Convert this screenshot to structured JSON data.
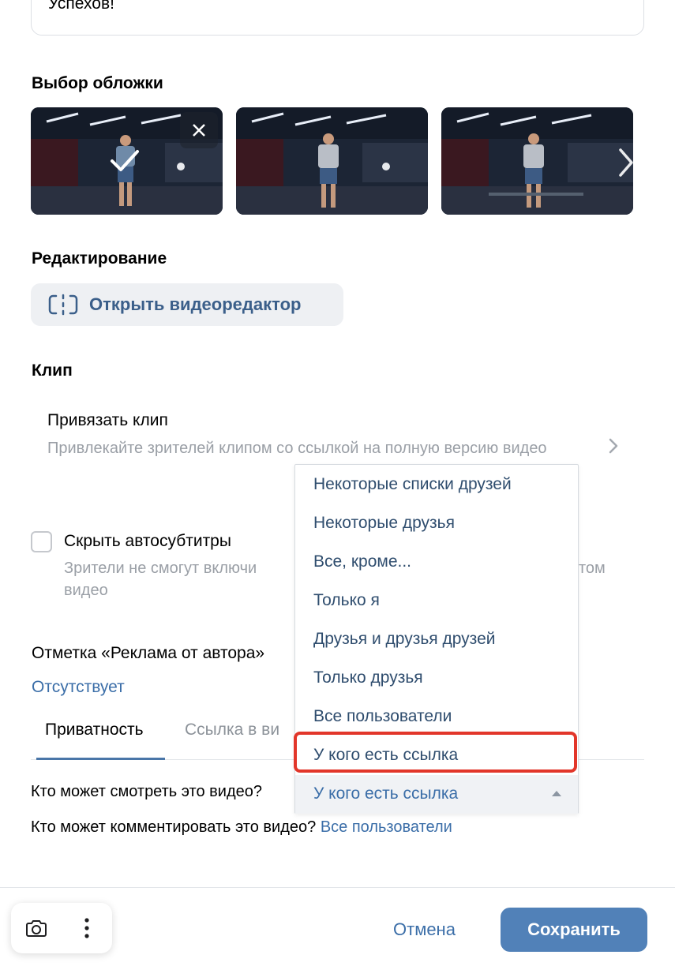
{
  "description": {
    "text": "Успехов!"
  },
  "cover": {
    "title": "Выбор обложки",
    "thumbnails": [
      {
        "label": "thumbnail-1",
        "selected": true,
        "removable": true
      },
      {
        "label": "thumbnail-2",
        "selected": false
      },
      {
        "label": "thumbnail-3",
        "selected": false
      }
    ],
    "icons": {
      "check": "check-icon",
      "close": "close-icon",
      "next": "chevron-right-icon"
    }
  },
  "editing": {
    "title": "Редактирование",
    "open_editor_label": "Открыть видеоредактор",
    "icon": "video-editor-icon"
  },
  "clip": {
    "title": "Клип",
    "attach_title": "Привязать клип",
    "attach_desc": "Привлекайте зрителей клипом со ссылкой на полную версию видео"
  },
  "subtitles": {
    "label": "Скрыть автосубтитры",
    "checked": false,
    "desc": "Зрители не смогут включи",
    "desc_tail": "том",
    "desc_line2": "видео"
  },
  "ad_mark": {
    "title": "Отметка «Реклама от автора»",
    "value": "Отсутствует"
  },
  "tabs": [
    {
      "label": "Приватность",
      "active": true
    },
    {
      "label": "Ссылка в ви",
      "active": false
    }
  ],
  "privacy": {
    "view_question": "Кто может смотреть это видео?",
    "comment_question": "Кто может комментировать это видео?",
    "comment_value": "Все пользователи"
  },
  "dropdown": {
    "options": [
      "Некоторые списки друзей",
      "Некоторые друзья",
      "Все, кроме...",
      "Только я",
      "Друзья и друзья друзей",
      "Только друзья",
      "Все пользователи",
      "У кого есть ссылка"
    ],
    "selected": "У кого есть ссылка",
    "highlight_color": "#e2362a"
  },
  "footer": {
    "cancel_label": "Отмена",
    "save_label": "Сохранить",
    "tools": [
      "camera-icon",
      "more-vertical-icon"
    ]
  },
  "colors": {
    "accent": "#5181b8",
    "link": "#3b6ea8",
    "muted": "#9a9fa6"
  }
}
